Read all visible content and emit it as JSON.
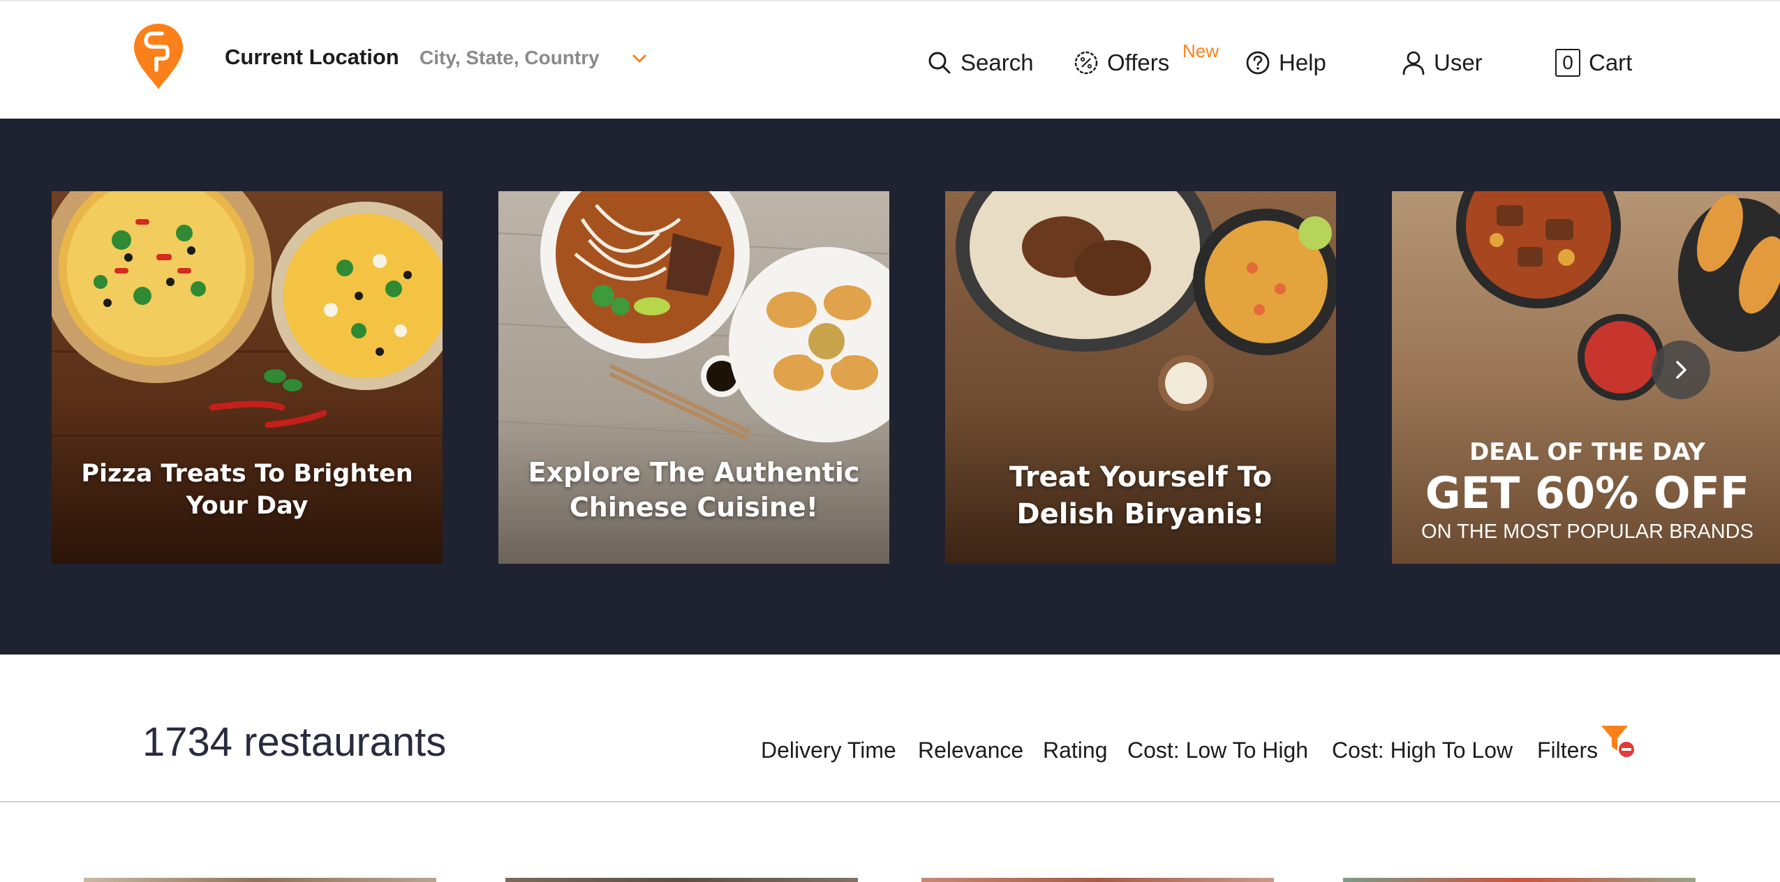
{
  "header": {
    "location_title": "Current Location",
    "location_sub": "City, State, Country",
    "nav": {
      "search": "Search",
      "offers": "Offers",
      "offers_badge": "New",
      "help": "Help",
      "user": "User",
      "cart_count": "0",
      "cart": "Cart"
    },
    "accent_color": "#fc8019"
  },
  "carousel": {
    "cards": [
      {
        "title_line1": "Pizza Treats To Brighten",
        "title_line2": "Your Day"
      },
      {
        "title_line1": "Explore The Authentic",
        "title_line2": "Chinese Cuisine!"
      },
      {
        "title_line1": "Treat Yourself To",
        "title_line2": "Delish Biryanis!"
      },
      {
        "line1": "DEAL OF THE DAY",
        "line2": "GET 60% OFF",
        "line3": "ON THE MOST POPULAR BRANDS"
      }
    ],
    "background_color": "#1f2230",
    "next_icon": "chevron-right-icon"
  },
  "listing": {
    "count_label": "1734 restaurants",
    "sort_options": [
      "Delivery Time",
      "Relevance",
      "Rating",
      "Cost: Low To High",
      "Cost: High To Low"
    ],
    "filters_label": "Filters"
  }
}
